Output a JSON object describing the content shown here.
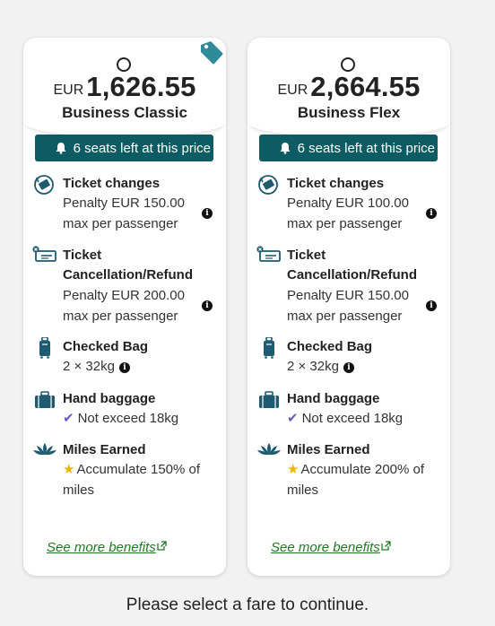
{
  "fares": [
    {
      "currency": "EUR",
      "amount": "1,626.55",
      "name": "Business Classic",
      "seats_label": "6 seats left at this price",
      "has_tag": true,
      "ticket_changes": {
        "title": "Ticket changes",
        "line1": "Penalty EUR 150.00",
        "line2": "max per passenger"
      },
      "cancellation": {
        "title": "Ticket Cancellation/Refund",
        "line1": "Penalty EUR 200.00",
        "line2": "max per passenger"
      },
      "checked_bag": {
        "title": "Checked Bag",
        "value": "2 × 32kg"
      },
      "hand_baggage": {
        "title": "Hand baggage",
        "value": "Not exceed 18kg"
      },
      "miles": {
        "title": "Miles Earned",
        "line1": "Accumulate 150% of",
        "line2": "miles"
      },
      "more_label": "See more benefits"
    },
    {
      "currency": "EUR",
      "amount": "2,664.55",
      "name": "Business Flex",
      "seats_label": "6 seats left at this price",
      "has_tag": false,
      "ticket_changes": {
        "title": "Ticket changes",
        "line1": "Penalty EUR 100.00",
        "line2": "max per passenger"
      },
      "cancellation": {
        "title": "Ticket Cancellation/Refund",
        "line1": "Penalty EUR 150.00",
        "line2": "max per passenger"
      },
      "checked_bag": {
        "title": "Checked Bag",
        "value": "2 × 32kg"
      },
      "hand_baggage": {
        "title": "Hand baggage",
        "value": "Not exceed 18kg"
      },
      "miles": {
        "title": "Miles Earned",
        "line1": "Accumulate 200% of",
        "line2": "miles"
      },
      "more_label": "See more benefits"
    }
  ],
  "footer_message": "Please select a fare to continue.",
  "colors": {
    "seats_banner": "#0e5c63",
    "tag": "#2f8a99",
    "link": "#1f7a22",
    "icon": "#1e5a70",
    "check": "#6a5bbf",
    "star": "#f0b400"
  },
  "icons": {
    "tag": "price-tag-icon",
    "bell": "bell-icon",
    "ticket_changes": "ticket-exchange-icon",
    "cancellation": "ticket-cancel-icon",
    "checked_bag": "suitcase-icon",
    "hand_baggage": "briefcase-icon",
    "miles": "lotus-icon",
    "info": "info-icon",
    "check": "check-icon",
    "star": "star-icon",
    "external": "external-link-icon"
  }
}
